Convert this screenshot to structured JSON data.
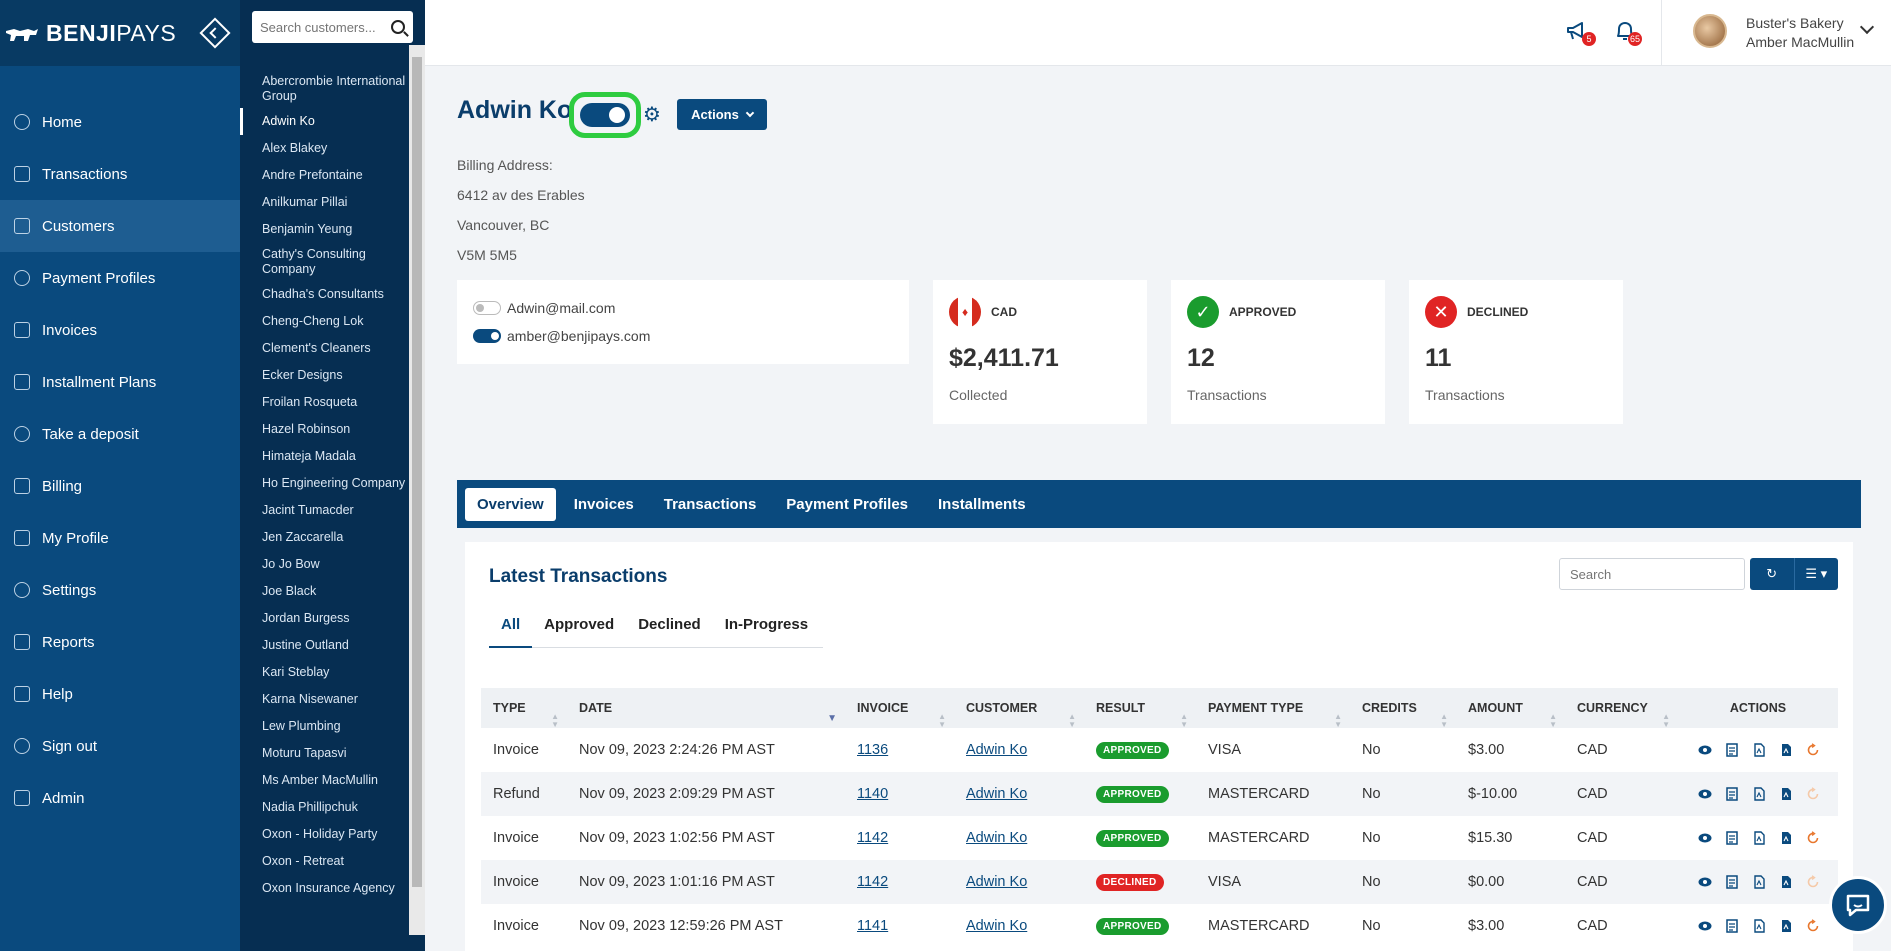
{
  "brand": {
    "name_bold": "BENJI",
    "name_light": "PAYS"
  },
  "nav": [
    {
      "label": "Home",
      "icon": "home-icon"
    },
    {
      "label": "Transactions",
      "icon": "transactions-icon"
    },
    {
      "label": "Customers",
      "icon": "customers-icon",
      "active": true
    },
    {
      "label": "Payment Profiles",
      "icon": "payment-profiles-icon"
    },
    {
      "label": "Invoices",
      "icon": "invoices-icon"
    },
    {
      "label": "Installment Plans",
      "icon": "installment-plans-icon"
    },
    {
      "label": "Take a deposit",
      "icon": "deposit-icon"
    },
    {
      "label": "Billing",
      "icon": "billing-icon"
    },
    {
      "label": "My Profile",
      "icon": "profile-icon"
    },
    {
      "label": "Settings",
      "icon": "settings-icon"
    },
    {
      "label": "Reports",
      "icon": "reports-icon"
    },
    {
      "label": "Help",
      "icon": "help-icon"
    },
    {
      "label": "Sign out",
      "icon": "sign-out-icon"
    },
    {
      "label": "Admin",
      "icon": "admin-icon"
    }
  ],
  "customer_search": {
    "placeholder": "Search customers..."
  },
  "customers": [
    "Abercrombie International Group",
    "Adwin Ko",
    "Alex Blakey",
    "Andre Prefontaine",
    "Anilkumar Pillai",
    "Benjamin Yeung",
    "Cathy's Consulting Company",
    "Chadha's Consultants",
    "Cheng-Cheng Lok",
    "Clement's Cleaners",
    "Ecker Designs",
    "Froilan Rosqueta",
    "Hazel Robinson",
    "Himateja Madala",
    "Ho Engineering Company",
    "Jacint Tumacder",
    "Jen Zaccarella",
    "Jo Jo Bow",
    "Joe Black",
    "Jordan Burgess",
    "Justine Outland",
    "Kari Steblay",
    "Karna Nisewaner",
    "Lew Plumbing",
    "Moturu Tapasvi",
    "Ms Amber MacMullin",
    "Nadia Phillipchuk",
    "Oxon - Holiday Party",
    "Oxon - Retreat",
    "Oxon Insurance Agency"
  ],
  "selected_customer": "Adwin Ko",
  "topbar": {
    "announcements_badge": "5",
    "notifications_badge": "65",
    "account_business": "Buster's Bakery",
    "account_user": "Amber MacMullin"
  },
  "customer": {
    "name": "Adwin Ko",
    "actions_label": "Actions",
    "billing_label": "Billing Address:",
    "address_line1": "6412 av des Erables",
    "address_line2": "Vancouver, BC",
    "address_line3": "V5M 5M5",
    "emails": [
      {
        "address": "Adwin@mail.com",
        "enabled": false
      },
      {
        "address": "amber@benjipays.com",
        "enabled": true
      }
    ]
  },
  "stats": {
    "currency": {
      "label": "CAD",
      "value": "$2,411.71",
      "sub": "Collected"
    },
    "approved": {
      "label": "APPROVED",
      "value": "12",
      "sub": "Transactions",
      "color": "#1a9c2e"
    },
    "declined": {
      "label": "DECLINED",
      "value": "11",
      "sub": "Transactions",
      "color": "#e02424"
    }
  },
  "tabs": [
    "Overview",
    "Invoices",
    "Transactions",
    "Payment Profiles",
    "Installments"
  ],
  "panel": {
    "title": "Latest Transactions",
    "search_placeholder": "Search",
    "subtabs": [
      "All",
      "Approved",
      "Declined",
      "In-Progress"
    ]
  },
  "table": {
    "columns": [
      "TYPE",
      "DATE",
      "INVOICE",
      "CUSTOMER",
      "RESULT",
      "PAYMENT TYPE",
      "CREDITS",
      "AMOUNT",
      "CURRENCY",
      "ACTIONS"
    ],
    "rows": [
      {
        "type": "Invoice",
        "date": "Nov 09, 2023 2:24:26 PM AST",
        "invoice": "1136",
        "customer": "Adwin Ko",
        "result": "APPROVED",
        "payment_type": "VISA",
        "credits": "No",
        "amount": "$3.00",
        "currency": "CAD"
      },
      {
        "type": "Refund",
        "date": "Nov 09, 2023 2:09:29 PM AST",
        "invoice": "1140",
        "customer": "Adwin Ko",
        "result": "APPROVED",
        "payment_type": "MASTERCARD",
        "credits": "No",
        "amount": "$-10.00",
        "currency": "CAD"
      },
      {
        "type": "Invoice",
        "date": "Nov 09, 2023 1:02:56 PM AST",
        "invoice": "1142",
        "customer": "Adwin Ko",
        "result": "APPROVED",
        "payment_type": "MASTERCARD",
        "credits": "No",
        "amount": "$15.30",
        "currency": "CAD"
      },
      {
        "type": "Invoice",
        "date": "Nov 09, 2023 1:01:16 PM AST",
        "invoice": "1142",
        "customer": "Adwin Ko",
        "result": "DECLINED",
        "payment_type": "VISA",
        "credits": "No",
        "amount": "$0.00",
        "currency": "CAD"
      },
      {
        "type": "Invoice",
        "date": "Nov 09, 2023 12:59:26 PM AST",
        "invoice": "1141",
        "customer": "Adwin Ko",
        "result": "APPROVED",
        "payment_type": "MASTERCARD",
        "credits": "No",
        "amount": "$3.00",
        "currency": "CAD"
      }
    ]
  },
  "colors": {
    "primary": "#0a4a7e",
    "approved": "#1a9c2e",
    "declined": "#e02424",
    "highlight": "#2ecc40"
  }
}
